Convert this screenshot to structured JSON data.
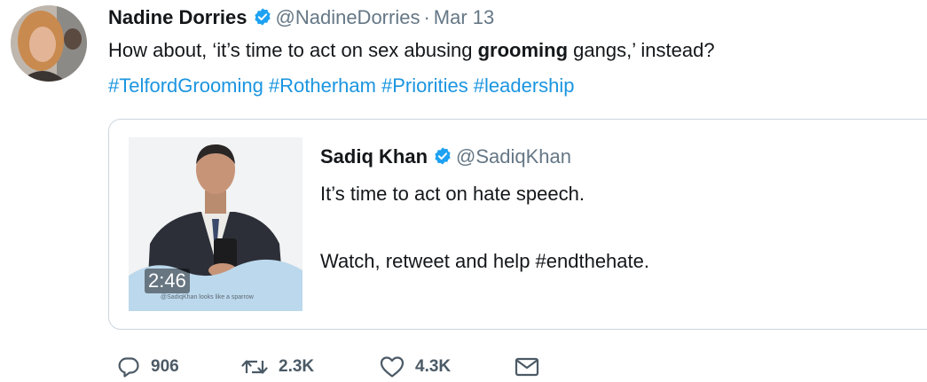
{
  "tweet": {
    "author": {
      "name": "Nadine Dorries",
      "handle": "@NadineDorries"
    },
    "separator": "·",
    "date": "Mar 13",
    "text": {
      "part1": "How about, ‘it’s time to act on sex abusing ",
      "bold": "grooming",
      "part2": " gangs,’ instead?"
    },
    "hashtags": [
      "#TelfordGrooming",
      "#Rotherham",
      "#Priorities",
      "#leadership"
    ]
  },
  "quoted": {
    "author": {
      "name": "Sadiq Khan",
      "handle": "@SadiqKhan"
    },
    "line1": "It’s time to act on hate speech.",
    "line2": "Watch, retweet and help #endthehate.",
    "video": {
      "duration": "2:46",
      "caption": "@SadiqKhan looks like a sparrow"
    }
  },
  "actions": {
    "reply_count": "906",
    "retweet_count": "2.3K",
    "like_count": "4.3K"
  },
  "icons": {
    "verified": "verified-badge-icon",
    "reply": "reply-icon",
    "retweet": "retweet-icon",
    "like": "heart-icon",
    "dm": "envelope-icon"
  },
  "colors": {
    "link": "#1b95e0",
    "verified": "#1da1f2",
    "muted": "#657786",
    "text": "#14171a",
    "border": "#ccd6dd"
  }
}
